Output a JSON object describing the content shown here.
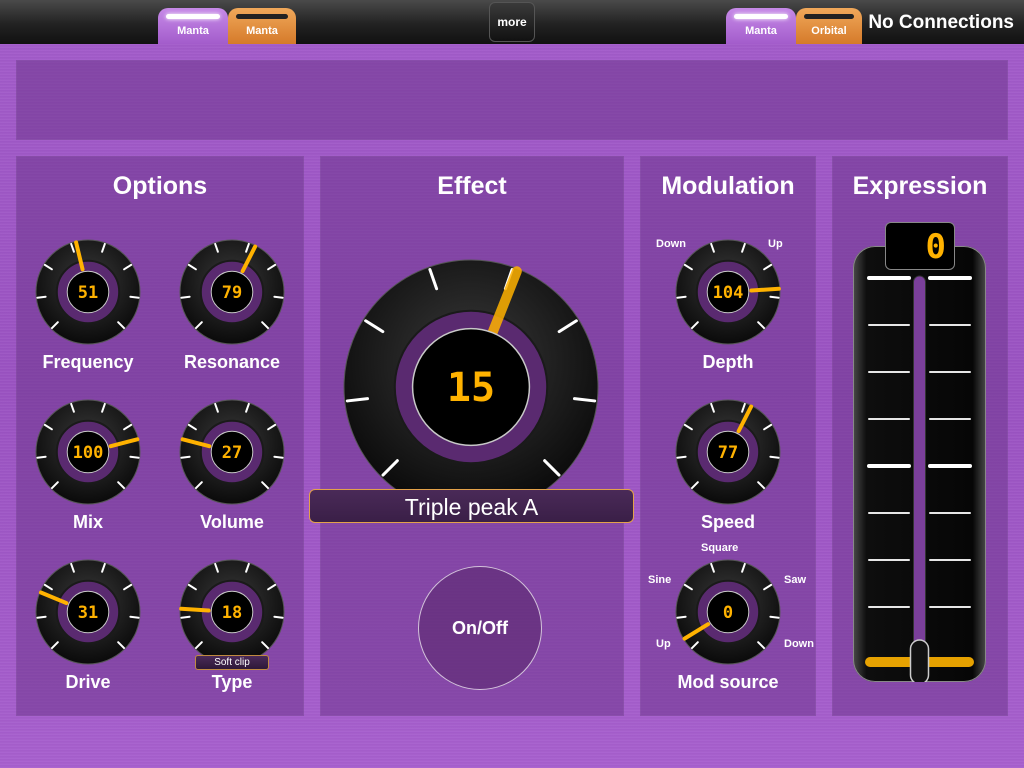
{
  "topbar": {
    "left_tabs": [
      "Manta",
      "Manta"
    ],
    "more_label": "more",
    "right_tabs": [
      "Manta",
      "Orbital"
    ],
    "connection_status": "No Connections"
  },
  "options": {
    "title": "Options",
    "knobs": [
      {
        "id": "frequency",
        "label": "Frequency",
        "value": "51",
        "level": 0.45
      },
      {
        "id": "resonance",
        "label": "Resonance",
        "value": "79",
        "level": 0.6
      },
      {
        "id": "mix",
        "label": "Mix",
        "value": "100",
        "level": 0.78
      },
      {
        "id": "volume",
        "label": "Volume",
        "value": "27",
        "level": 0.22
      },
      {
        "id": "drive",
        "label": "Drive",
        "value": "31",
        "level": 0.25
      },
      {
        "id": "type",
        "label": "Type",
        "value": "18",
        "level": 0.18,
        "selection": "Soft clip"
      }
    ]
  },
  "effect": {
    "title": "Effect",
    "value": "15",
    "level": 0.58,
    "preset": "Triple peak A",
    "onoff_label": "On/Off"
  },
  "modulation": {
    "title": "Modulation",
    "depth": {
      "label": "Depth",
      "value": "104",
      "level": 0.82,
      "min_label": "Down",
      "max_label": "Up"
    },
    "speed": {
      "label": "Speed",
      "value": "77",
      "level": 0.6
    },
    "mod_source": {
      "label": "Mod source",
      "value": "0",
      "level": 0.05,
      "positions": [
        "Up",
        "Sine",
        "Square",
        "Saw",
        "Down"
      ]
    }
  },
  "expression": {
    "title": "Expression",
    "value": "0",
    "level": 0.0
  },
  "colors": {
    "accent": "#ffb200",
    "panel": "#6e378c",
    "background": "#a35ccb"
  }
}
